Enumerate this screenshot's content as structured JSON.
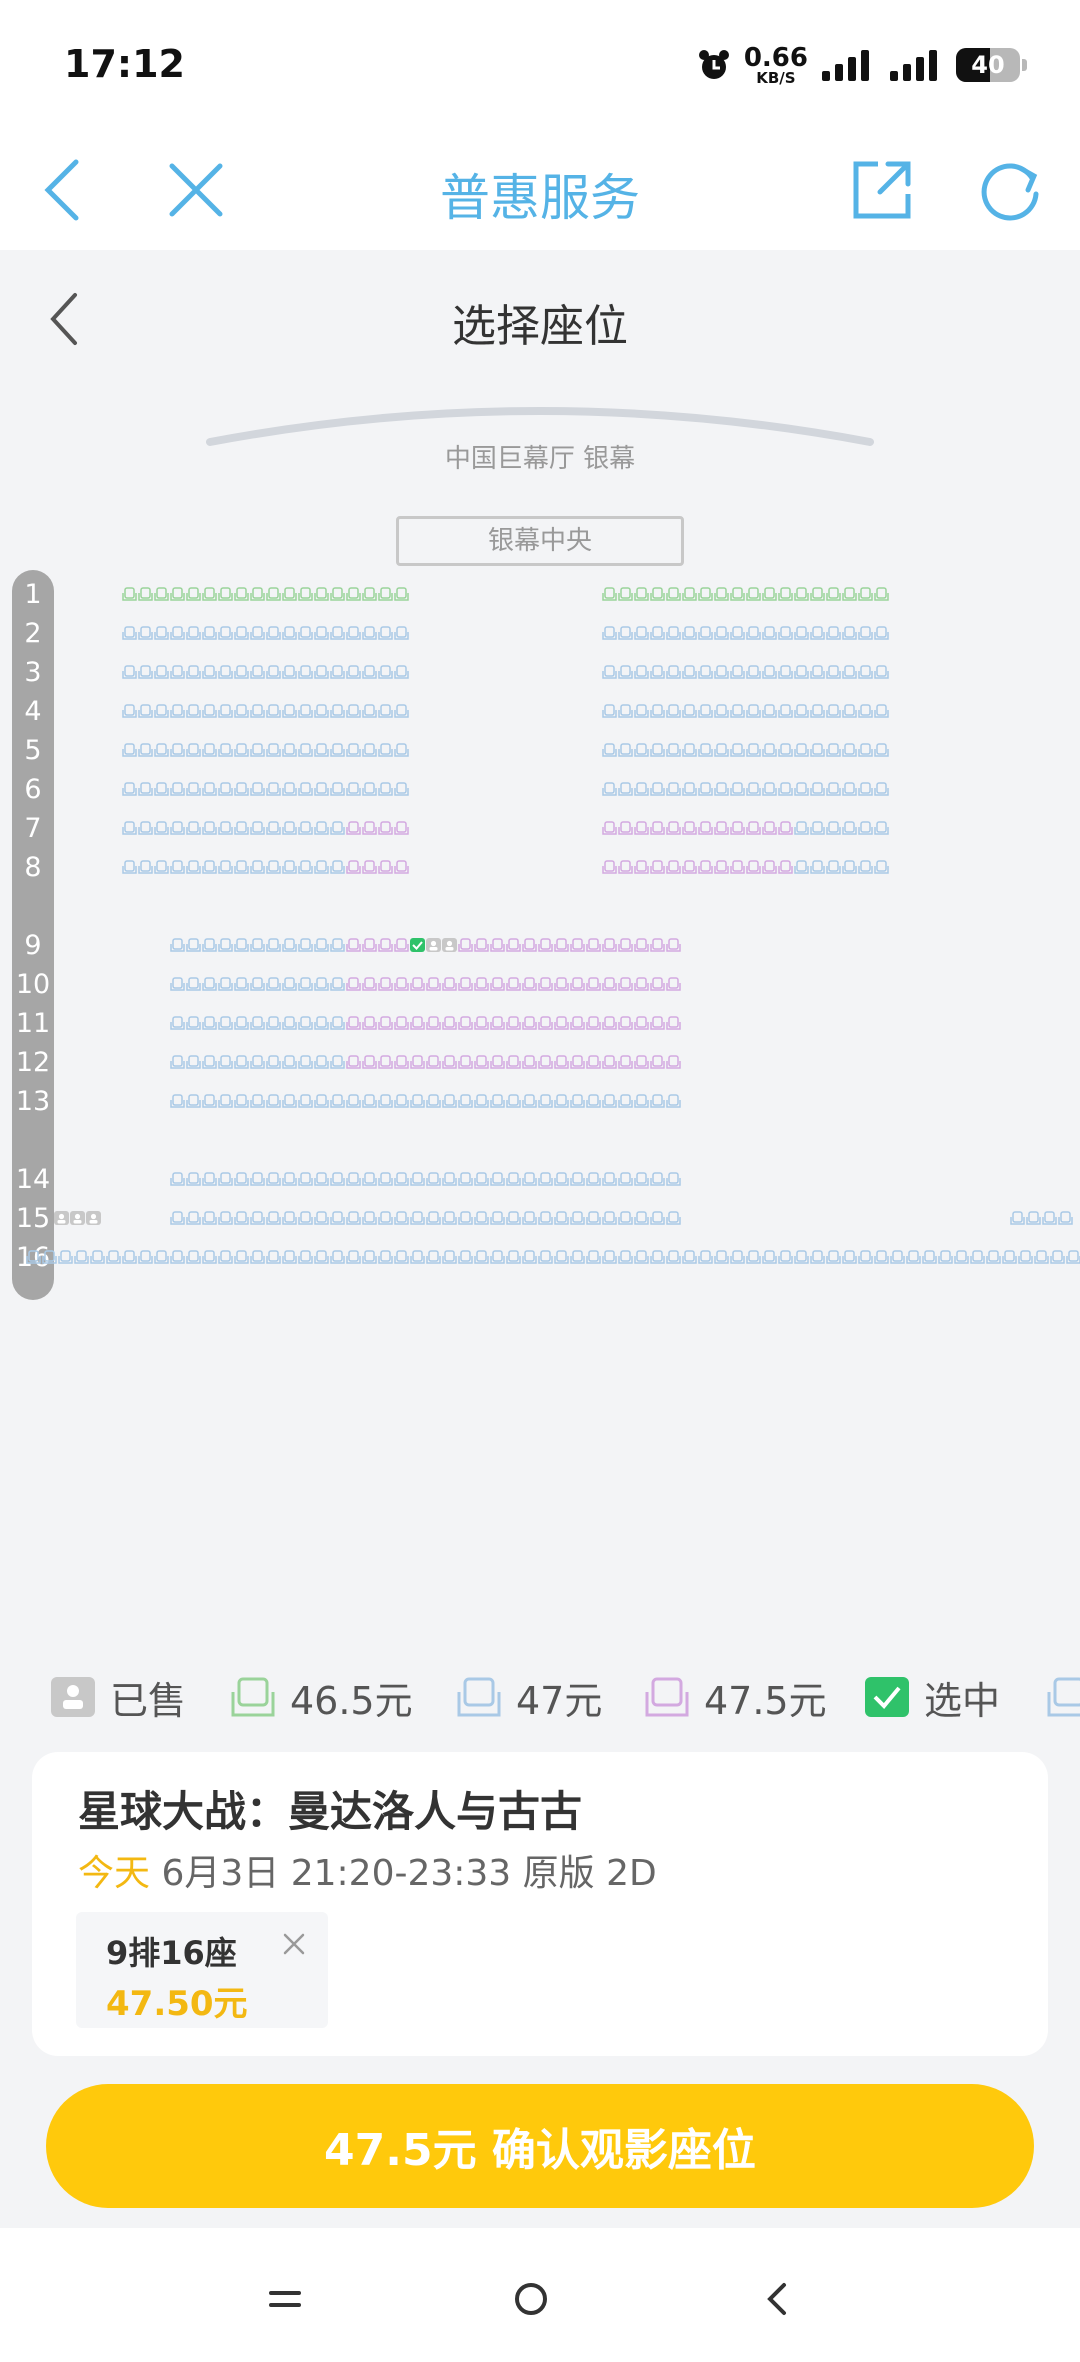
{
  "status_bar": {
    "time": "17:12",
    "net_speed_value": "0.66",
    "net_speed_unit": "KB/S",
    "battery": "40"
  },
  "nav": {
    "title": "普惠服务",
    "back_icon": "chevron-left-icon",
    "close_icon": "close-icon",
    "share_icon": "share-icon",
    "refresh_icon": "refresh-icon"
  },
  "page": {
    "title": "选择座位"
  },
  "screen": {
    "label": "中国巨幕厅 银幕",
    "center_label": "银幕中央"
  },
  "rows": [
    "1",
    "2",
    "3",
    "4",
    "5",
    "6",
    "7",
    "8",
    "9",
    "10",
    "11",
    "12",
    "13",
    "14",
    "15",
    "16"
  ],
  "legend": [
    {
      "label": "已售",
      "kind": "sold"
    },
    {
      "label": "46.5元",
      "kind": "green"
    },
    {
      "label": "47元",
      "kind": "blue"
    },
    {
      "label": "47.5元",
      "kind": "purple"
    },
    {
      "label": "选中",
      "kind": "selected"
    }
  ],
  "colors": {
    "green": "#9ad39a",
    "blue": "#a9c9e6",
    "purple": "#d3a9e0",
    "sold": "#c8c8c8",
    "selected": "#2fc26a",
    "accent": "#ffc90c",
    "nav_blue": "#55b3e6",
    "price_yellow": "#f3b812"
  },
  "movie": {
    "title": "星球大战：曼达洛人与古古",
    "today": "今天",
    "details": "6月3日 21:20-23:33 原版 2D"
  },
  "ticket": {
    "seat": "9排16座",
    "price": "47.50元"
  },
  "confirm": {
    "label": "47.5元 确认观影座位"
  }
}
